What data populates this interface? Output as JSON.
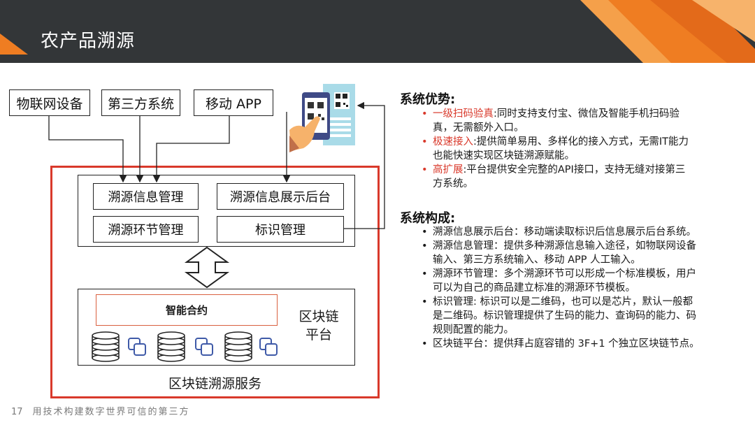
{
  "header": {
    "title": "农产品溯源"
  },
  "diagram": {
    "sources": [
      "物联网设备",
      "第三方系统",
      "移动 APP"
    ],
    "modules": [
      "溯源信息管理",
      "溯源信息展示后台",
      "溯源环节管理",
      "标识管理"
    ],
    "contract": "智能合约",
    "chain_label": [
      "区块链",
      "平台"
    ],
    "service_label": "区块链溯源服务"
  },
  "advantages": {
    "title": "系统优势:",
    "items": [
      {
        "key": "一级扫码验真",
        "text": ":同时支持支付宝、微信及智能手机扫码验",
        "cont": "真，无需额外入口。"
      },
      {
        "key": "极速接入",
        "text": ":提供简单易用、多样化的接入方式，无需IT能力",
        "cont": "也能快速实现区块链溯源赋能。"
      },
      {
        "key": "高扩展",
        "text": ":平台提供安全完整的API接口，支持无缝对接第三",
        "cont": "方系统。"
      }
    ]
  },
  "composition": {
    "title": "系统构成:",
    "items": [
      [
        "溯源信息展示后台：移动端读取标识后信息展示后台系统。"
      ],
      [
        "溯源信息管理：提供多种溯源信息输入途径，如物联网设备",
        "输入、第三方系统输入、移动 APP 人工输入。"
      ],
      [
        "溯源环节管理：多个溯源环节可以形成一个标准模板，用户",
        "可以为自己的商品建立标准的溯源环节模板。"
      ],
      [
        "标识管理: 标识可以是二维码，也可以是芯片，默认一般都",
        "是二维码。标识管理提供了生码的能力、查询码的能力、码",
        "规则配置的能力。"
      ],
      [
        "区块链平台：提供拜占庭容错的 3F+1 个独立区块链节点。"
      ]
    ]
  },
  "footer": {
    "page": "17",
    "text": "用技术构建数字世界可信的第三方"
  },
  "colors": {
    "accent": "#d9392b",
    "header_bg": "#333638",
    "orange": "#ef7d22"
  }
}
